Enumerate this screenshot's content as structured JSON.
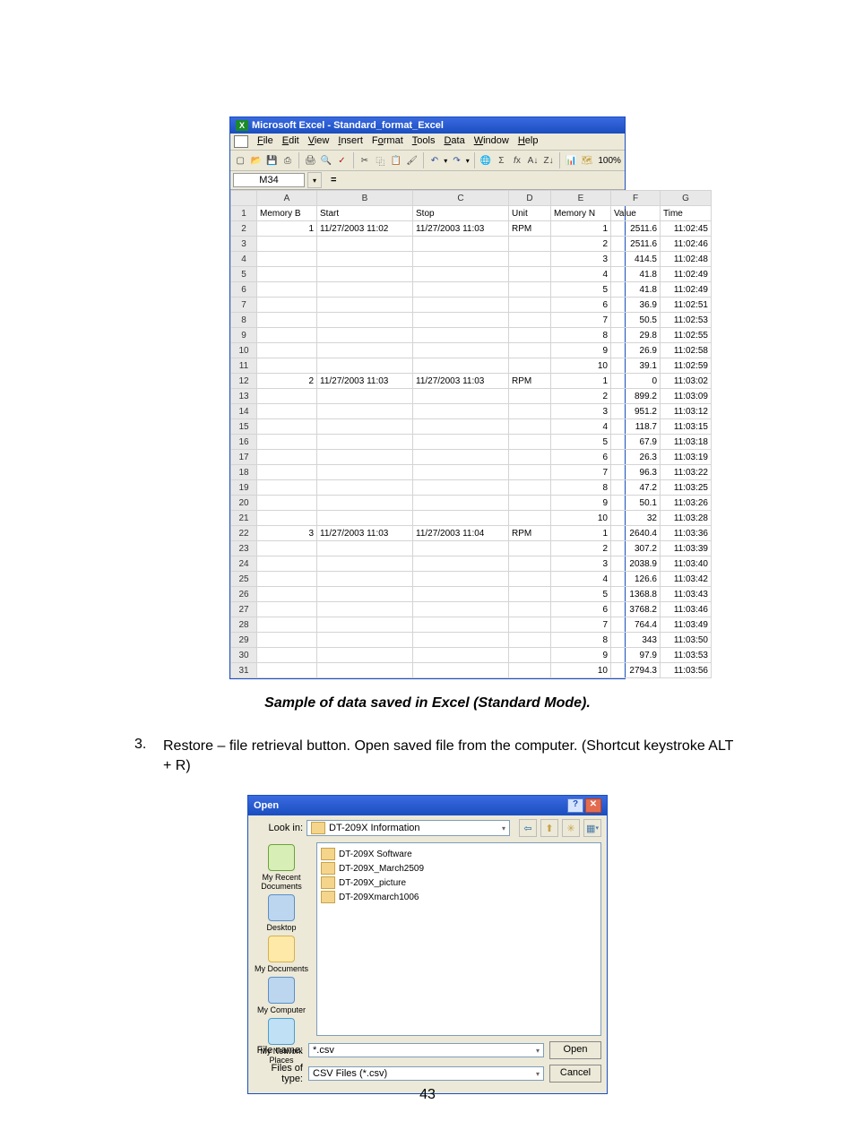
{
  "page_number": "43",
  "excel": {
    "title_prefix": "Microsoft Excel - ",
    "filename": "Standard_format_Excel",
    "menus": [
      "File",
      "Edit",
      "View",
      "Insert",
      "Format",
      "Tools",
      "Data",
      "Window",
      "Help"
    ],
    "zoom": "100%",
    "name_box": "M34",
    "fx": "=",
    "col_headers": [
      "A",
      "B",
      "C",
      "D",
      "E",
      "F",
      "G"
    ],
    "header_row": {
      "A": "Memory B",
      "B": "Start",
      "C": "Stop",
      "D": "Unit",
      "E": "Memory N",
      "F": "Value",
      "G": "Time"
    },
    "rows": [
      {
        "n": "2",
        "A": "1",
        "B": "11/27/2003 11:02",
        "C": "11/27/2003 11:03",
        "D": "RPM",
        "E": "1",
        "F": "2511.6",
        "G": "11:02:45"
      },
      {
        "n": "3",
        "A": "",
        "B": "",
        "C": "",
        "D": "",
        "E": "2",
        "F": "2511.6",
        "G": "11:02:46"
      },
      {
        "n": "4",
        "A": "",
        "B": "",
        "C": "",
        "D": "",
        "E": "3",
        "F": "414.5",
        "G": "11:02:48"
      },
      {
        "n": "5",
        "A": "",
        "B": "",
        "C": "",
        "D": "",
        "E": "4",
        "F": "41.8",
        "G": "11:02:49"
      },
      {
        "n": "6",
        "A": "",
        "B": "",
        "C": "",
        "D": "",
        "E": "5",
        "F": "41.8",
        "G": "11:02:49"
      },
      {
        "n": "7",
        "A": "",
        "B": "",
        "C": "",
        "D": "",
        "E": "6",
        "F": "36.9",
        "G": "11:02:51"
      },
      {
        "n": "8",
        "A": "",
        "B": "",
        "C": "",
        "D": "",
        "E": "7",
        "F": "50.5",
        "G": "11:02:53"
      },
      {
        "n": "9",
        "A": "",
        "B": "",
        "C": "",
        "D": "",
        "E": "8",
        "F": "29.8",
        "G": "11:02:55"
      },
      {
        "n": "10",
        "A": "",
        "B": "",
        "C": "",
        "D": "",
        "E": "9",
        "F": "26.9",
        "G": "11:02:58"
      },
      {
        "n": "11",
        "A": "",
        "B": "",
        "C": "",
        "D": "",
        "E": "10",
        "F": "39.1",
        "G": "11:02:59"
      },
      {
        "n": "12",
        "A": "2",
        "B": "11/27/2003 11:03",
        "C": "11/27/2003 11:03",
        "D": "RPM",
        "E": "1",
        "F": "0",
        "G": "11:03:02"
      },
      {
        "n": "13",
        "A": "",
        "B": "",
        "C": "",
        "D": "",
        "E": "2",
        "F": "899.2",
        "G": "11:03:09"
      },
      {
        "n": "14",
        "A": "",
        "B": "",
        "C": "",
        "D": "",
        "E": "3",
        "F": "951.2",
        "G": "11:03:12"
      },
      {
        "n": "15",
        "A": "",
        "B": "",
        "C": "",
        "D": "",
        "E": "4",
        "F": "118.7",
        "G": "11:03:15"
      },
      {
        "n": "16",
        "A": "",
        "B": "",
        "C": "",
        "D": "",
        "E": "5",
        "F": "67.9",
        "G": "11:03:18"
      },
      {
        "n": "17",
        "A": "",
        "B": "",
        "C": "",
        "D": "",
        "E": "6",
        "F": "26.3",
        "G": "11:03:19"
      },
      {
        "n": "18",
        "A": "",
        "B": "",
        "C": "",
        "D": "",
        "E": "7",
        "F": "96.3",
        "G": "11:03:22"
      },
      {
        "n": "19",
        "A": "",
        "B": "",
        "C": "",
        "D": "",
        "E": "8",
        "F": "47.2",
        "G": "11:03:25"
      },
      {
        "n": "20",
        "A": "",
        "B": "",
        "C": "",
        "D": "",
        "E": "9",
        "F": "50.1",
        "G": "11:03:26"
      },
      {
        "n": "21",
        "A": "",
        "B": "",
        "C": "",
        "D": "",
        "E": "10",
        "F": "32",
        "G": "11:03:28"
      },
      {
        "n": "22",
        "A": "3",
        "B": "11/27/2003 11:03",
        "C": "11/27/2003 11:04",
        "D": "RPM",
        "E": "1",
        "F": "2640.4",
        "G": "11:03:36"
      },
      {
        "n": "23",
        "A": "",
        "B": "",
        "C": "",
        "D": "",
        "E": "2",
        "F": "307.2",
        "G": "11:03:39"
      },
      {
        "n": "24",
        "A": "",
        "B": "",
        "C": "",
        "D": "",
        "E": "3",
        "F": "2038.9",
        "G": "11:03:40"
      },
      {
        "n": "25",
        "A": "",
        "B": "",
        "C": "",
        "D": "",
        "E": "4",
        "F": "126.6",
        "G": "11:03:42"
      },
      {
        "n": "26",
        "A": "",
        "B": "",
        "C": "",
        "D": "",
        "E": "5",
        "F": "1368.8",
        "G": "11:03:43"
      },
      {
        "n": "27",
        "A": "",
        "B": "",
        "C": "",
        "D": "",
        "E": "6",
        "F": "3768.2",
        "G": "11:03:46"
      },
      {
        "n": "28",
        "A": "",
        "B": "",
        "C": "",
        "D": "",
        "E": "7",
        "F": "764.4",
        "G": "11:03:49"
      },
      {
        "n": "29",
        "A": "",
        "B": "",
        "C": "",
        "D": "",
        "E": "8",
        "F": "343",
        "G": "11:03:50"
      },
      {
        "n": "30",
        "A": "",
        "B": "",
        "C": "",
        "D": "",
        "E": "9",
        "F": "97.9",
        "G": "11:03:53"
      },
      {
        "n": "31",
        "A": "",
        "B": "",
        "C": "",
        "D": "",
        "E": "10",
        "F": "2794.3",
        "G": "11:03:56"
      }
    ]
  },
  "caption": "Sample of data saved in Excel (Standard Mode).",
  "paragraph": {
    "num": "3.",
    "text": "Restore – file retrieval button. Open saved file from the computer. (Shortcut keystroke ALT + R)"
  },
  "open_dialog": {
    "title": "Open",
    "lookin_label": "Look in:",
    "lookin_value": "DT-209X Information",
    "places": [
      "My Recent Documents",
      "Desktop",
      "My Documents",
      "My Computer",
      "My Network Places"
    ],
    "folders": [
      "DT-209X Software",
      "DT-209X_March2509",
      "DT-209X_picture",
      "DT-209Xmarch1006"
    ],
    "filename_label": "File name:",
    "filename_value": "*.csv",
    "filetype_label": "Files of type:",
    "filetype_value": "CSV Files (*.csv)",
    "open_btn": "Open",
    "cancel_btn": "Cancel"
  }
}
